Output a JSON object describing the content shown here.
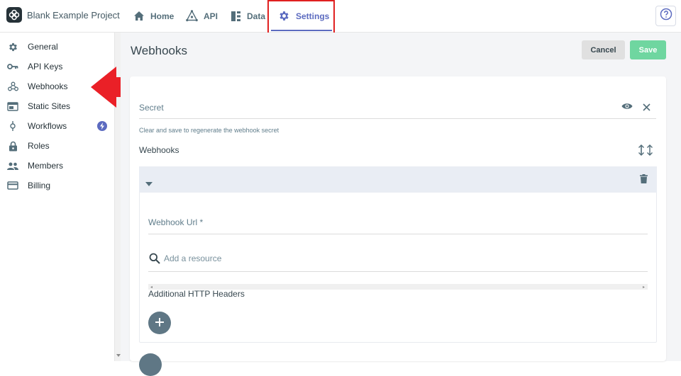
{
  "header": {
    "project_name": "Blank Example Project",
    "tabs": [
      {
        "label": "Home",
        "icon": "home-icon"
      },
      {
        "label": "API",
        "icon": "api-icon"
      },
      {
        "label": "Data",
        "icon": "data-icon"
      },
      {
        "label": "Settings",
        "icon": "gear-icon",
        "active": true
      }
    ],
    "help_icon": "help-icon"
  },
  "sidebar": {
    "items": [
      {
        "label": "General",
        "icon": "gear-icon"
      },
      {
        "label": "API Keys",
        "icon": "key-icon"
      },
      {
        "label": "Webhooks",
        "icon": "webhook-icon"
      },
      {
        "label": "Static Sites",
        "icon": "browser-icon"
      },
      {
        "label": "Workflows",
        "icon": "workflow-icon",
        "badge_icon": "lightning-icon"
      },
      {
        "label": "Roles",
        "icon": "lock-icon"
      },
      {
        "label": "Members",
        "icon": "people-icon"
      },
      {
        "label": "Billing",
        "icon": "credit-card-icon"
      }
    ]
  },
  "main": {
    "title": "Webhooks",
    "cancel_label": "Cancel",
    "save_label": "Save",
    "secret_label": "Secret",
    "secret_help": "Clear and save to regenerate the webhook secret",
    "webhooks_heading": "Webhooks",
    "webhook_url_label": "Webhook Url *",
    "resource_placeholder": "Add a resource",
    "headers_label": "Additional HTTP Headers"
  },
  "colors": {
    "accent": "#5c6bc0",
    "save": "#6fd6a0",
    "annotation": "#e02020"
  }
}
